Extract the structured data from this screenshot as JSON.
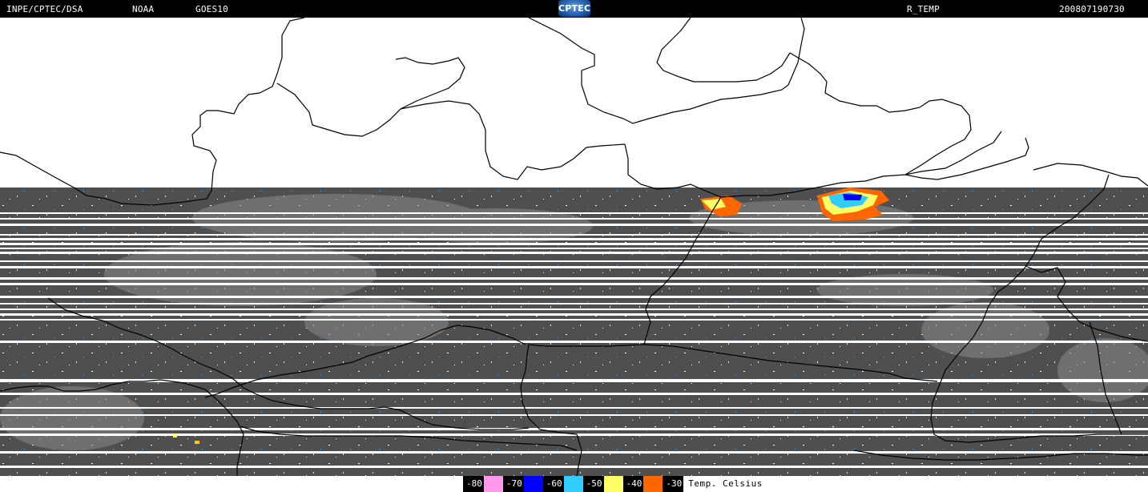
{
  "header": {
    "source": "INPE/CPTEC/DSA",
    "agency": "NOAA",
    "satellite": "GOES10",
    "logo_text": "CPTEC",
    "product": "R_TEMP",
    "timestamp": "200807190730"
  },
  "legend": {
    "items": [
      {
        "label": "-80",
        "color": "#ff99ee"
      },
      {
        "label": "-70",
        "color": "#0000ff"
      },
      {
        "label": "-60",
        "color": "#33ccff"
      },
      {
        "label": "-50",
        "color": "#ffff66"
      },
      {
        "label": "-40",
        "color": "#ff6600"
      },
      {
        "label": "-30",
        "color": "#000000"
      }
    ],
    "unit_label": "Temp. Celsius"
  },
  "map": {
    "background": "#ffffff",
    "imagery_color": "#555555",
    "border_color": "#000000"
  }
}
